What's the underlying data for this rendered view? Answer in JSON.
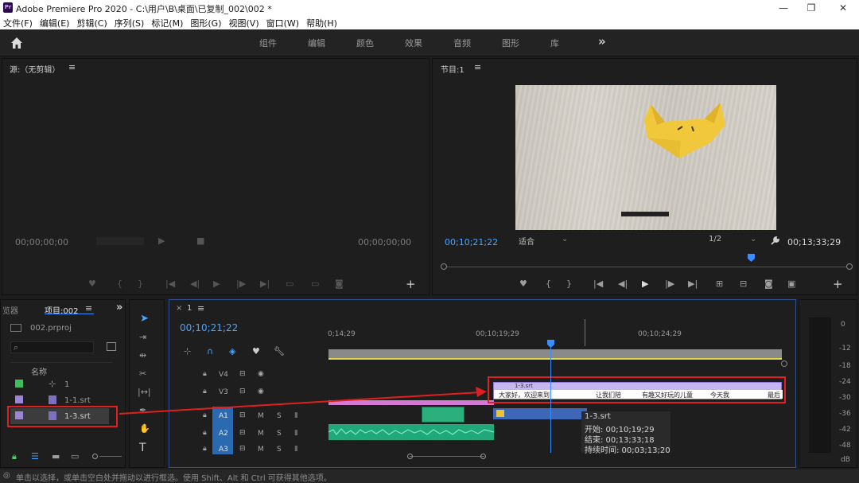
{
  "app": {
    "logo_text": "Pr",
    "title": "Adobe Premiere Pro 2020 - C:\\用户\\B\\桌面\\已复制_002\\002 *",
    "minimize": "—",
    "maximize": "❐",
    "close": "✕"
  },
  "menu": [
    "文件(F)",
    "编辑(E)",
    "剪辑(C)",
    "序列(S)",
    "标记(M)",
    "图形(G)",
    "视图(V)",
    "窗口(W)",
    "帮助(H)"
  ],
  "workspaces": [
    "组件",
    "编辑",
    "颜色",
    "效果",
    "音频",
    "图形",
    "库"
  ],
  "workspace_more": "»",
  "source_panel": {
    "title": "源:（无剪辑）",
    "menu_icon": "≡",
    "timecode_left": "00;00;00;00",
    "timecode_right": "00;00;00;00"
  },
  "program_panel": {
    "title": "节目:1",
    "menu_icon": "≡",
    "timecode": "00;10;21;22",
    "fit": "适合",
    "resolution": "1/2",
    "duration": "00;13;33;29",
    "add": "+"
  },
  "project_panel": {
    "tab_prev": "览器",
    "tab": "项目:002",
    "menu_icon": "≡",
    "more": "»",
    "file": "002.prproj",
    "column_name": "名称",
    "items": [
      {
        "label": "1",
        "color": "#3fbf5a"
      },
      {
        "label": "1-1.srt",
        "color": "#9b86d6"
      },
      {
        "label": "1-3.srt",
        "color": "#9b86d6"
      }
    ]
  },
  "timeline": {
    "tab_close": "×",
    "tab": "1",
    "menu_icon": "≡",
    "timecode": "00;10;21;22",
    "ruler": [
      "0;14;29",
      "00;10;19;29",
      "00;10;24;29"
    ],
    "tracks_video": [
      "V4",
      "V3"
    ],
    "tracks_audio": [
      "A1",
      "A2",
      "A3"
    ],
    "track_m": "M",
    "track_s": "S",
    "caption_clip": {
      "name": "1-3.srt",
      "segments": [
        "大家好，欢迎来到",
        "让我们陪",
        "有趣又好玩的儿童",
        "今天我",
        "最后"
      ]
    },
    "tooltip": {
      "name": "1-3.srt",
      "start": "开始: 00;10;19;29",
      "end": "结束: 00;13;33;18",
      "duration": "持续时间: 00;03;13;20"
    },
    "meter_labels": [
      "0",
      "-12",
      "-18",
      "-24",
      "-30",
      "-36",
      "-42",
      "-48",
      "dB"
    ]
  },
  "status": "单击以选择，或单击空白处并拖动以进行框选。使用 Shift、Alt 和 Ctrl 可获得其他选项。"
}
